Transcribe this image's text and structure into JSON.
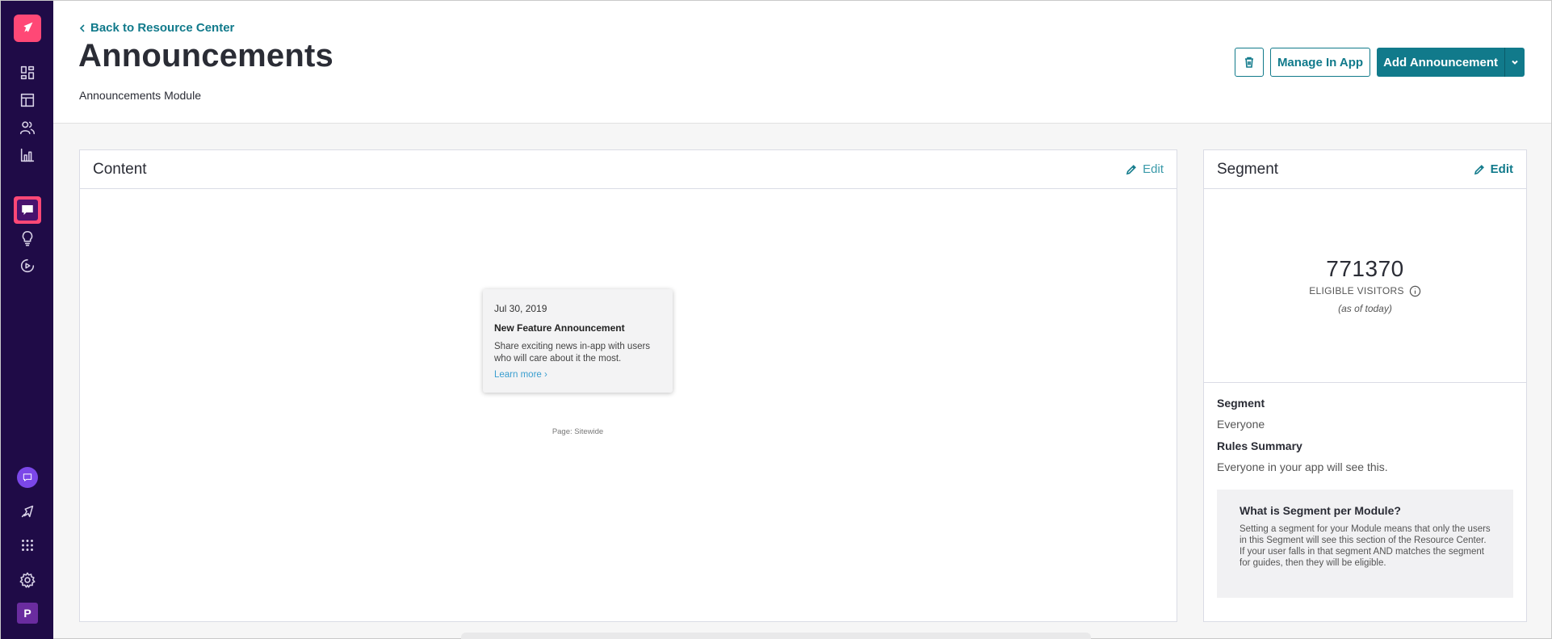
{
  "header": {
    "back_link": "Back to Resource Center",
    "title": "Announcements",
    "subtitle": "Announcements Module",
    "manage_label": "Manage In App",
    "add_label": "Add Announcement"
  },
  "content_card": {
    "title": "Content",
    "edit_label": "Edit",
    "preview": {
      "date": "Jul 30, 2019",
      "title": "New Feature Announcement",
      "description": "Share exciting news in-app with users who will care about it the most.",
      "link": "Learn more ›"
    },
    "page_label": "Page: Sitewide"
  },
  "segment_card": {
    "title": "Segment",
    "edit_label": "Edit",
    "visitors_count": "771370",
    "visitors_label": "ELIGIBLE VISITORS",
    "as_of": "(as of today)",
    "segment_heading": "Segment",
    "segment_value": "Everyone",
    "rules_heading": "Rules Summary",
    "rules_value": "Everyone in your app will see this.",
    "info_title": "What is Segment per Module?",
    "info_text": "Setting a segment for your Module means that only the users in this Segment will see this section of the Resource Center. If your user falls in that segment AND matches the segment for guides, then they will be eligible."
  },
  "sidebar": {
    "avatar_letter": "P",
    "icons": [
      "rocket-logo-icon",
      "dashboard-icon",
      "layout-icon",
      "people-icon",
      "bar-chart-icon",
      "chat-bubble-icon",
      "lightbulb-icon",
      "replay-icon",
      "chat-circle-icon",
      "launch-icon",
      "apps-grid-icon",
      "gear-icon"
    ]
  },
  "colors": {
    "sidebar_bg": "#1f0b47",
    "accent": "#117a8b",
    "brand_pink": "#ff4876"
  }
}
